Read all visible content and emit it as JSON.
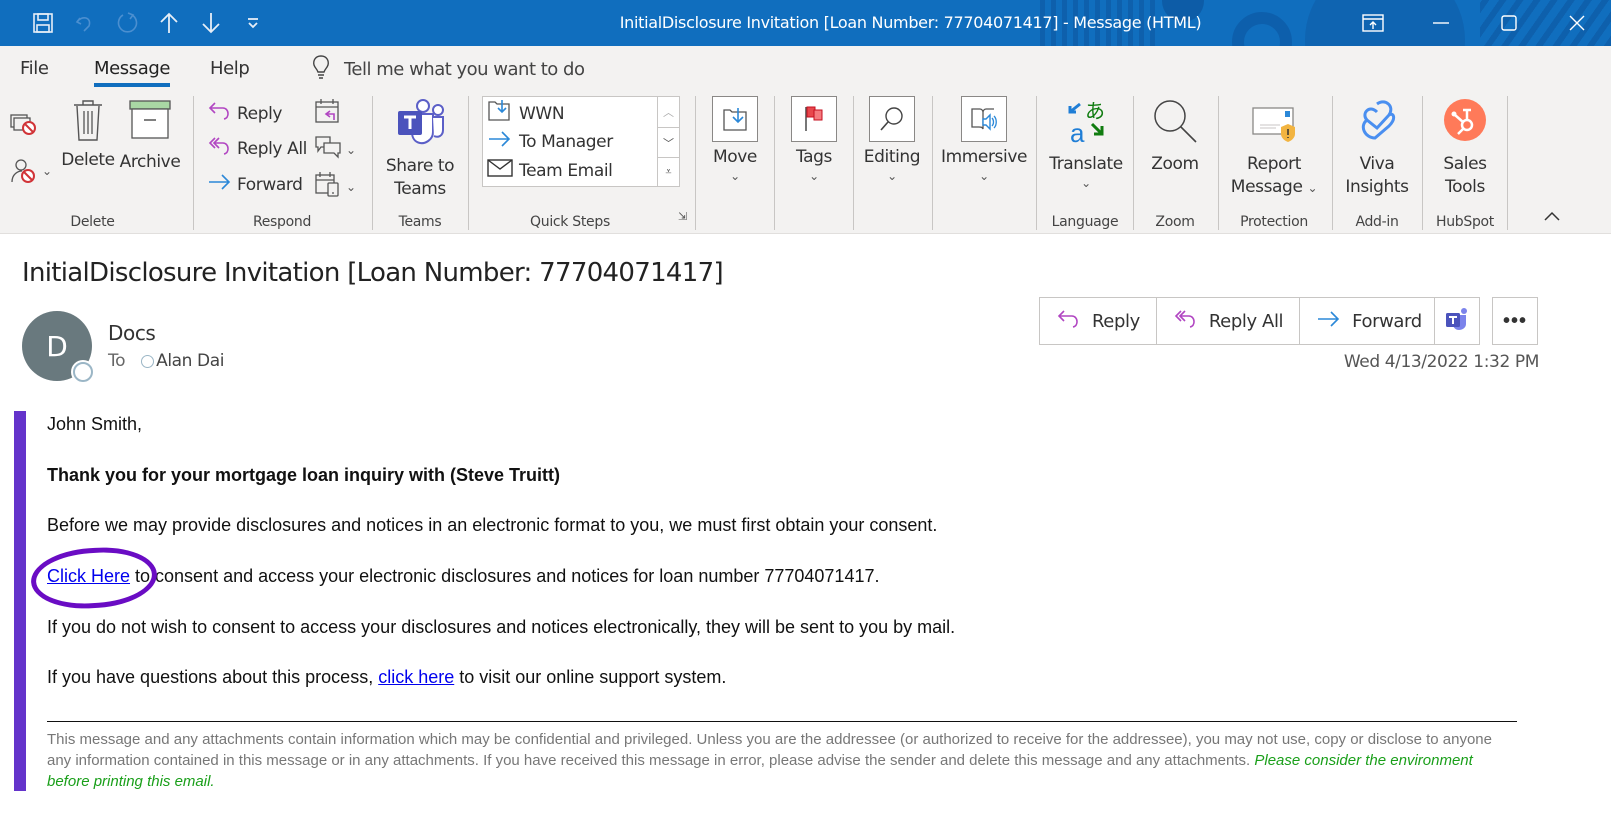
{
  "window": {
    "title": "InitialDisclosure Invitation [Loan Number: 77704071417]  -  Message (HTML)",
    "qat_icons": [
      "save-icon",
      "undo-icon",
      "redo-icon",
      "previous-item-icon",
      "next-item-icon",
      "customize-qat-icon"
    ],
    "controls": [
      "restore-ribbon-icon",
      "minimize-icon",
      "maximize-icon",
      "close-icon"
    ]
  },
  "menu": {
    "tabs": [
      {
        "label": "File",
        "active": false
      },
      {
        "label": "Message",
        "active": true
      },
      {
        "label": "Help",
        "active": false
      }
    ],
    "tell_me": "Tell me what you want to do"
  },
  "ribbon": {
    "groups": {
      "delete": "Delete",
      "respond": "Respond",
      "teams": "Teams",
      "quick_steps": "Quick Steps",
      "language": "Language",
      "zoom": "Zoom",
      "protection": "Protection",
      "addin": "Add-in",
      "hubspot": "HubSpot"
    },
    "delete_btn": "Delete",
    "archive_btn": "Archive",
    "reply": "Reply",
    "reply_all": "Reply All",
    "forward": "Forward",
    "share_teams_1": "Share to",
    "share_teams_2": "Teams",
    "quick_steps": [
      "WWN",
      "To Manager",
      "Team Email"
    ],
    "move": "Move",
    "tags": "Tags",
    "editing": "Editing",
    "immersive": "Immersive",
    "translate": "Translate",
    "zoom_btn": "Zoom",
    "report_1": "Report",
    "report_2": "Message",
    "viva_1": "Viva",
    "viva_2": "Insights",
    "sales_1": "Sales",
    "sales_2": "Tools"
  },
  "message": {
    "subject": "InitialDisclosure Invitation [Loan Number: 77704071417]",
    "avatar_initial": "D",
    "sender": "Docs",
    "to_label": "To",
    "recipient": "Alan Dai",
    "actions": {
      "reply": "Reply",
      "reply_all": "Reply All",
      "forward": "Forward"
    },
    "datetime": "Wed 4/13/2022 1:32 PM"
  },
  "body": {
    "greeting": "John Smith,",
    "heading": "Thank you for your mortgage loan inquiry with (Steve Truitt)",
    "para1": "Before we may provide disclosures and notices in an electronic format to you, we must first obtain your consent.",
    "link1": "Click Here",
    "para2_rest": " to consent and access your electronic disclosures and notices for loan number 77704071417.",
    "para3": "If you do not wish to consent to access your disclosures and notices electronically, they will be sent to you by mail.",
    "para4_pre": "If you have questions about this process, ",
    "link2": "click here",
    "para4_post": " to visit our online support system.",
    "disclaimer": "This message and any attachments contain information which may be confidential and privileged. Unless you are the addressee (or authorized to receive for the addressee), you may not use, copy or disclose to anyone any information contained in this message or in any attachments. If you have received this message in error, please advise the sender and delete this message and any attachments. ",
    "disclaimer_green": "Please consider the environment before printing this email."
  },
  "colors": {
    "titlebar": "#106ebe",
    "accent_bar": "#6433cb",
    "annotation_circle": "#6a0cc4",
    "link": "#0000ee",
    "green_note": "#1a9f1a"
  }
}
